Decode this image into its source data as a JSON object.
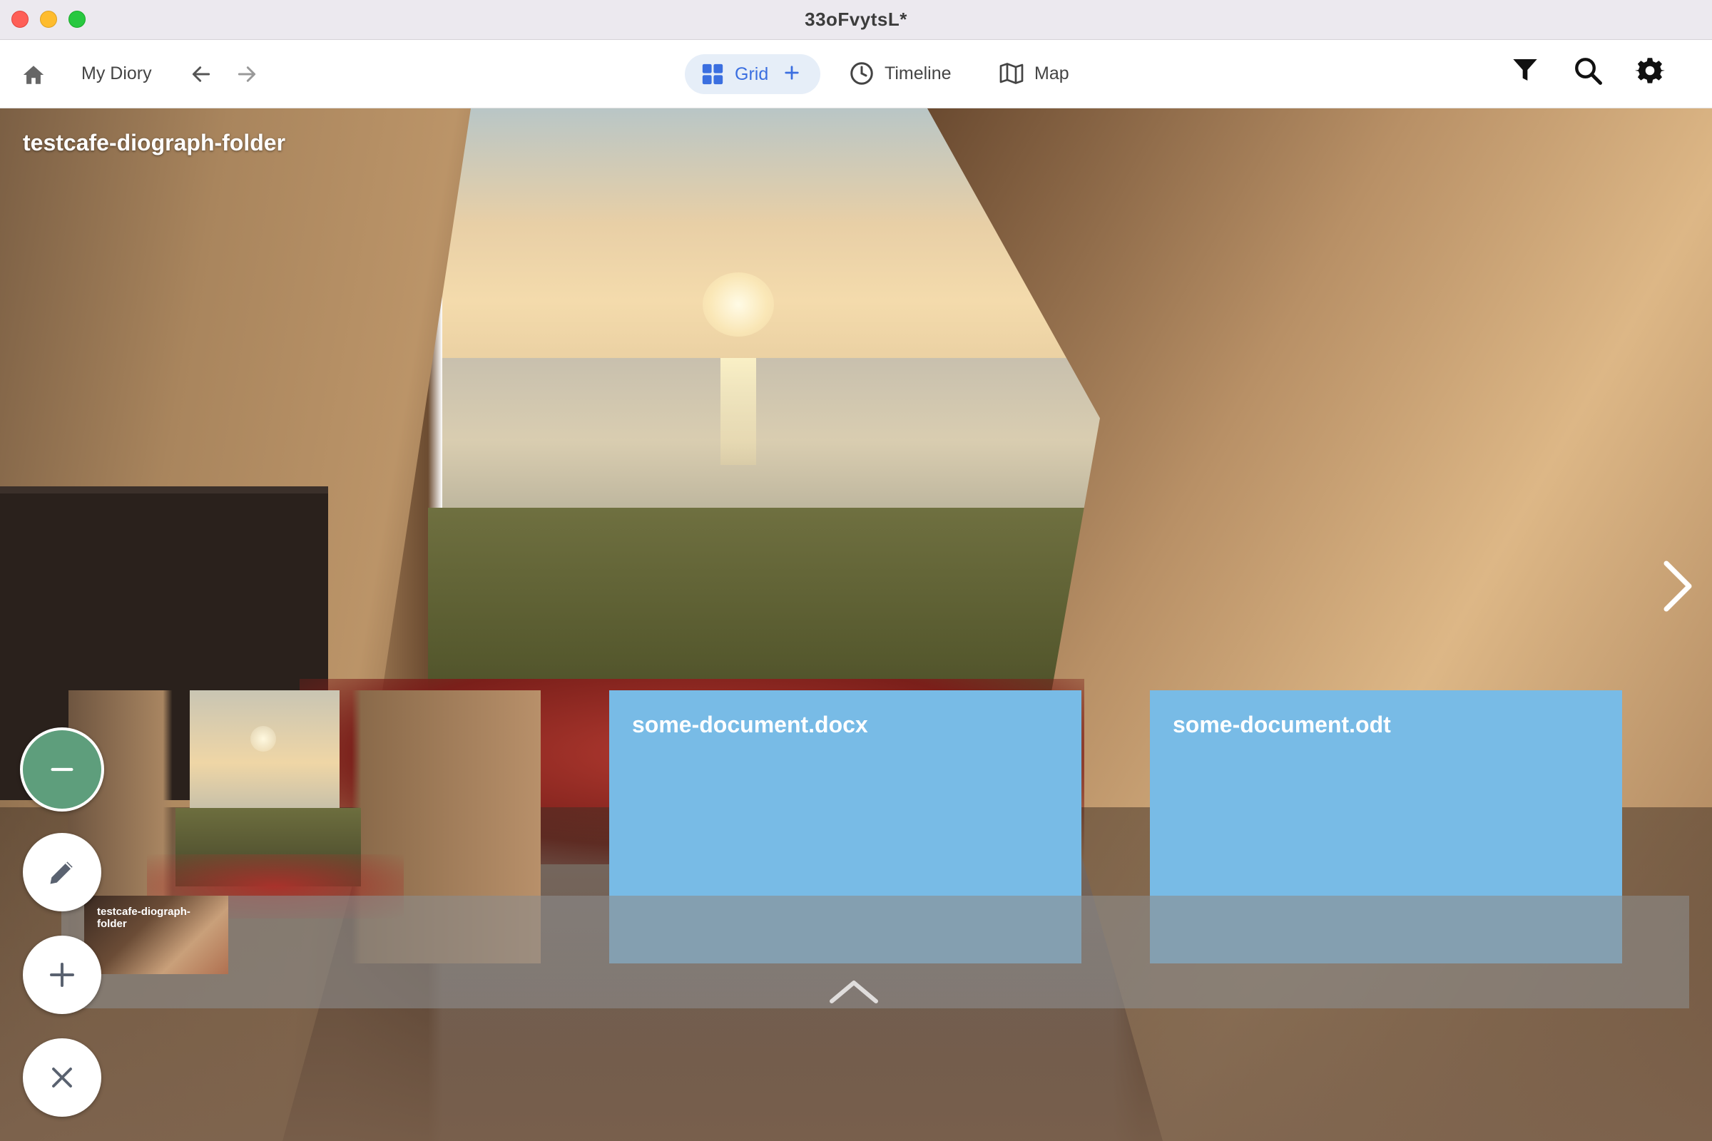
{
  "window": {
    "title": "33oFvytsL*"
  },
  "toolbar": {
    "home_icon": "home-icon",
    "title_label": "My Diory",
    "back_icon": "arrow-left-icon",
    "forward_icon": "arrow-right-icon",
    "views": [
      {
        "label": "Grid",
        "icon": "grid-icon",
        "active": true
      },
      {
        "label": "Timeline",
        "icon": "clock-icon",
        "active": false
      },
      {
        "label": "Map",
        "icon": "map-icon",
        "active": false
      }
    ],
    "grid_add_icon": "plus-icon",
    "right_icons": [
      "filter-icon",
      "search-icon",
      "gear-icon"
    ]
  },
  "colors": {
    "accent": "#3b6fe0",
    "active_pill": "#e6eef8",
    "doc_card": "#78bbe6",
    "fab_minus": "#5e9e7c"
  },
  "stage": {
    "folder_title": "testcafe-diograph-folder",
    "next_icon": "chevron-right-icon"
  },
  "cards": [
    {
      "type": "image",
      "title": ""
    },
    {
      "type": "document",
      "title": "some-document.docx"
    },
    {
      "type": "document",
      "title": "some-document.odt"
    }
  ],
  "tray": {
    "thumbnail_label": "testcafe-diograph-folder",
    "expand_icon": "chevron-up-icon"
  },
  "fabs": [
    "minus-icon",
    "pencil-icon",
    "plus-icon",
    "close-icon"
  ]
}
